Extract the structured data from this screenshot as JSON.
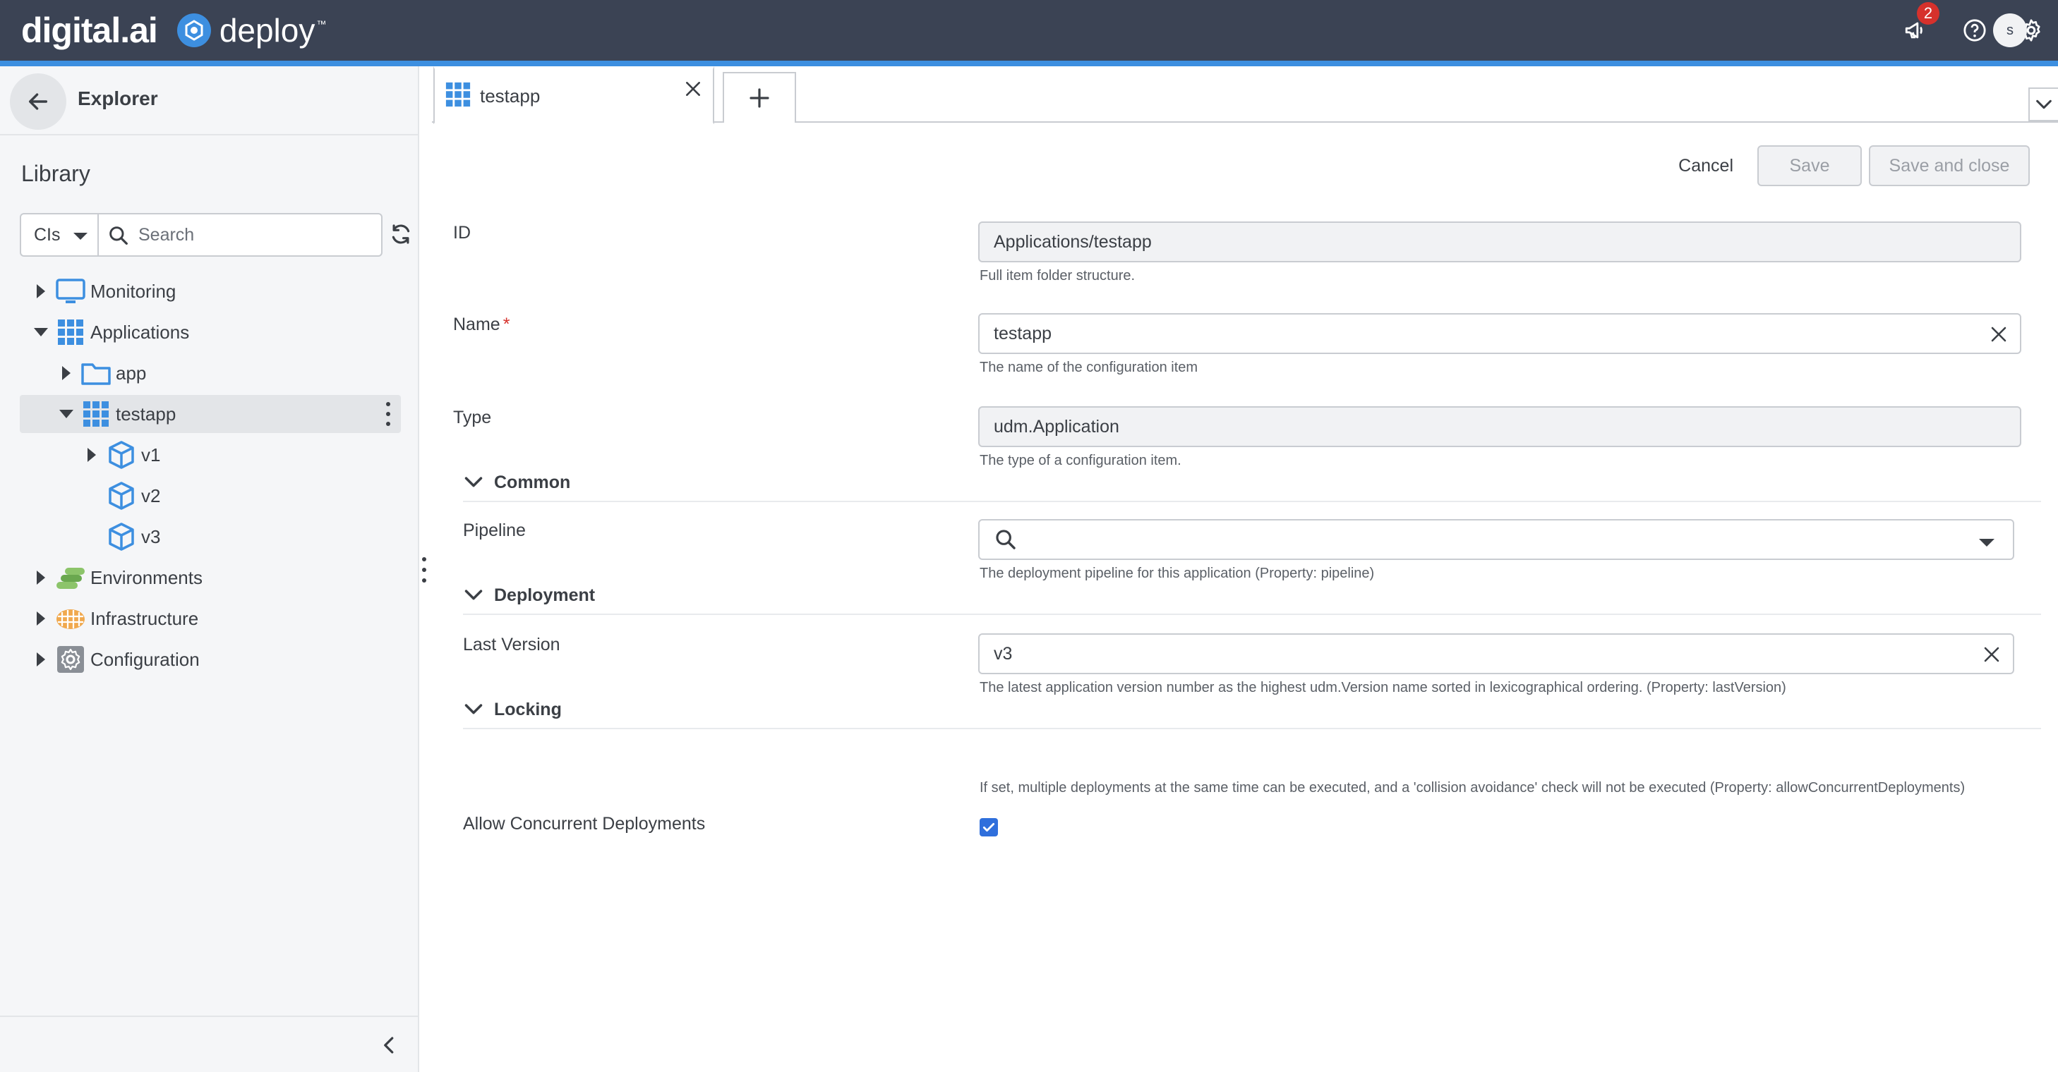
{
  "header": {
    "brand": "digital.ai",
    "product": "deploy",
    "trademark": "™",
    "notification_count": "2",
    "user_initial": "s"
  },
  "colors": {
    "topbar": "#3b4354",
    "accent": "#3d8fe0",
    "badge": "#d6312c",
    "checkbox": "#2f6fdc"
  },
  "sidebar": {
    "explorer_title": "Explorer",
    "library_title": "Library",
    "ci_select": "CIs",
    "search_placeholder": "Search",
    "tree": [
      {
        "label": "Monitoring",
        "icon": "monitor-icon",
        "state": "collapsed"
      },
      {
        "label": "Applications",
        "icon": "applications-grid-icon",
        "state": "expanded"
      },
      {
        "label": "app",
        "icon": "folder-icon",
        "state": "collapsed"
      },
      {
        "label": "testapp",
        "icon": "application-grid-icon",
        "state": "expanded",
        "selected": true
      },
      {
        "label": "v1",
        "icon": "package-icon",
        "state": "collapsed"
      },
      {
        "label": "v2",
        "icon": "package-icon",
        "state": "leaf"
      },
      {
        "label": "v3",
        "icon": "package-icon",
        "state": "leaf"
      },
      {
        "label": "Environments",
        "icon": "environments-icon",
        "state": "collapsed"
      },
      {
        "label": "Infrastructure",
        "icon": "infrastructure-icon",
        "state": "collapsed"
      },
      {
        "label": "Configuration",
        "icon": "configuration-gear-icon",
        "state": "collapsed"
      }
    ]
  },
  "tabs": [
    {
      "label": "testapp",
      "icon": "application-grid-icon"
    }
  ],
  "actions": {
    "cancel": "Cancel",
    "save": "Save",
    "save_close": "Save and close"
  },
  "form": {
    "id": {
      "label": "ID",
      "value": "Applications/testapp",
      "help": "Full item folder structure."
    },
    "name": {
      "label": "Name",
      "required_mark": "*",
      "value": "testapp",
      "help": "The name of the configuration item"
    },
    "type": {
      "label": "Type",
      "value": "udm.Application",
      "help": "The type of a configuration item."
    },
    "sections": {
      "common": "Common",
      "deployment": "Deployment",
      "locking": "Locking"
    },
    "pipeline": {
      "label": "Pipeline",
      "value": "",
      "help": "The deployment pipeline for this application (Property: pipeline)"
    },
    "last_version": {
      "label": "Last Version",
      "value": "v3",
      "help": "The latest application version number as the highest udm.Version name sorted in lexicographical ordering. (Property: lastVersion)"
    },
    "allow_concurrent": {
      "label": "Allow Concurrent Deployments",
      "checked": true,
      "help": "If set, multiple deployments at the same time can be executed, and a 'collision avoidance' check will not be executed (Property: allowConcurrentDeployments)"
    }
  }
}
